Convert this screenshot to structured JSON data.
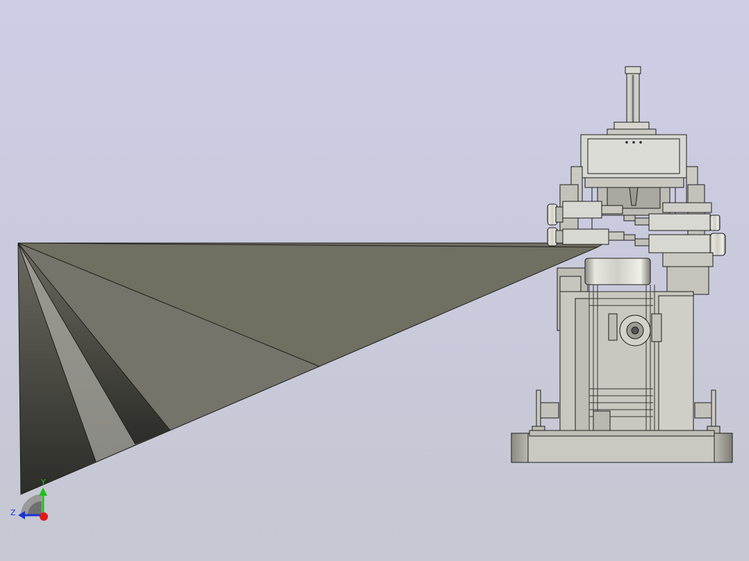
{
  "viewport": {
    "background_top": "#cdcde6",
    "background_bottom": "#c6c7d2"
  },
  "triad": {
    "y_label": "Y",
    "z_label": "Z",
    "y_color": "#1fbf1f",
    "z_color": "#1a33d9",
    "x_color": "#e01a1a"
  }
}
